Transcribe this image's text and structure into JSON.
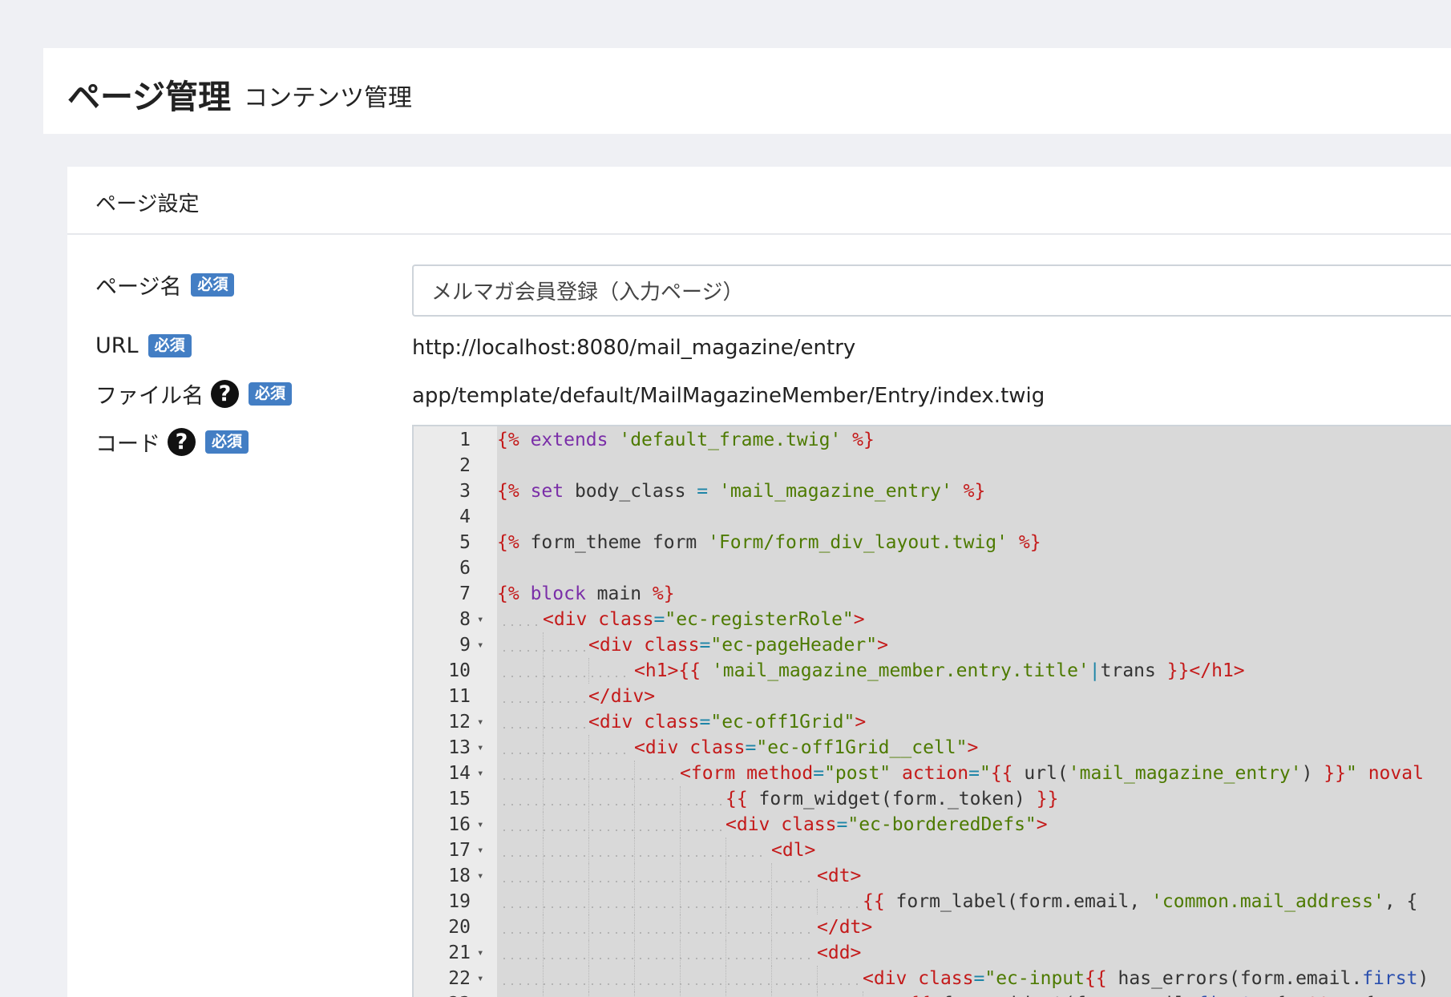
{
  "page_header": {
    "title": "ページ管理",
    "subtitle": "コンテンツ管理"
  },
  "card": {
    "title": "ページ設定"
  },
  "fields": {
    "page_name": {
      "label": "ページ名",
      "badge": "必須",
      "value": "メルマガ会員登録（入力ページ）"
    },
    "url": {
      "label": "URL",
      "badge": "必須",
      "value": "http://localhost:8080/mail_magazine/entry"
    },
    "file_name": {
      "label": "ファイル名",
      "badge": "必須",
      "help_icon": "question-circle-icon",
      "help_glyph": "?",
      "value": "app/template/default/MailMagazineMember/Entry/index.twig"
    },
    "code": {
      "label": "コード",
      "badge": "必須",
      "help_icon": "question-circle-icon",
      "help_glyph": "?"
    }
  },
  "colors": {
    "badge": "#437ec4",
    "page_bg": "#eff0f4",
    "editor_bg": "#d9d9d9",
    "gutter_bg": "#ebebeb",
    "twig_delim": "#c41a1a",
    "twig_keyword": "#7a2ea8",
    "string": "#4d7a00",
    "operator": "#1e85a7",
    "property": "#2a4fae"
  },
  "editor": {
    "fold_glyph": "▾",
    "lines": [
      {
        "n": "1",
        "fold": false,
        "indent": 0,
        "tokens": [
          [
            "delim",
            "{%"
          ],
          [
            "plain",
            " "
          ],
          [
            "kw",
            "extends"
          ],
          [
            "plain",
            " "
          ],
          [
            "str",
            "'default_frame.twig'"
          ],
          [
            "plain",
            " "
          ],
          [
            "delim",
            "%}"
          ]
        ]
      },
      {
        "n": "2",
        "fold": false,
        "indent": 0,
        "tokens": []
      },
      {
        "n": "3",
        "fold": false,
        "indent": 0,
        "tokens": [
          [
            "delim",
            "{%"
          ],
          [
            "plain",
            " "
          ],
          [
            "kw",
            "set"
          ],
          [
            "plain",
            " body_class "
          ],
          [
            "op",
            "="
          ],
          [
            "plain",
            " "
          ],
          [
            "str",
            "'mail_magazine_entry'"
          ],
          [
            "plain",
            " "
          ],
          [
            "delim",
            "%}"
          ]
        ]
      },
      {
        "n": "4",
        "fold": false,
        "indent": 0,
        "tokens": []
      },
      {
        "n": "5",
        "fold": false,
        "indent": 0,
        "tokens": [
          [
            "delim",
            "{%"
          ],
          [
            "plain",
            " form_theme form "
          ],
          [
            "str",
            "'Form/form_div_layout.twig'"
          ],
          [
            "plain",
            " "
          ],
          [
            "delim",
            "%}"
          ]
        ]
      },
      {
        "n": "6",
        "fold": false,
        "indent": 0,
        "tokens": []
      },
      {
        "n": "7",
        "fold": false,
        "indent": 0,
        "tokens": [
          [
            "delim",
            "{%"
          ],
          [
            "plain",
            " "
          ],
          [
            "kw",
            "block"
          ],
          [
            "plain",
            " main "
          ],
          [
            "delim",
            "%}"
          ]
        ]
      },
      {
        "n": "8",
        "fold": true,
        "indent": 1,
        "tokens": [
          [
            "tag",
            "<div"
          ],
          [
            "plain",
            " "
          ],
          [
            "attr",
            "class"
          ],
          [
            "op",
            "="
          ],
          [
            "attrval",
            "\"ec-registerRole\""
          ],
          [
            "tag",
            ">"
          ]
        ]
      },
      {
        "n": "9",
        "fold": true,
        "indent": 2,
        "tokens": [
          [
            "tag",
            "<div"
          ],
          [
            "plain",
            " "
          ],
          [
            "attr",
            "class"
          ],
          [
            "op",
            "="
          ],
          [
            "attrval",
            "\"ec-pageHeader\""
          ],
          [
            "tag",
            ">"
          ]
        ]
      },
      {
        "n": "10",
        "fold": false,
        "indent": 3,
        "tokens": [
          [
            "tag",
            "<h1>"
          ],
          [
            "delim",
            "{{"
          ],
          [
            "plain",
            " "
          ],
          [
            "str",
            "'mail_magazine_member.entry.title'"
          ],
          [
            "op",
            "|"
          ],
          [
            "plain",
            "trans "
          ],
          [
            "delim",
            "}}"
          ],
          [
            "tag",
            "</h1>"
          ]
        ]
      },
      {
        "n": "11",
        "fold": false,
        "indent": 2,
        "tokens": [
          [
            "tag",
            "</div>"
          ]
        ]
      },
      {
        "n": "12",
        "fold": true,
        "indent": 2,
        "tokens": [
          [
            "tag",
            "<div"
          ],
          [
            "plain",
            " "
          ],
          [
            "attr",
            "class"
          ],
          [
            "op",
            "="
          ],
          [
            "attrval",
            "\"ec-off1Grid\""
          ],
          [
            "tag",
            ">"
          ]
        ]
      },
      {
        "n": "13",
        "fold": true,
        "indent": 3,
        "tokens": [
          [
            "tag",
            "<div"
          ],
          [
            "plain",
            " "
          ],
          [
            "attr",
            "class"
          ],
          [
            "op",
            "="
          ],
          [
            "attrval",
            "\"ec-off1Grid__cell\""
          ],
          [
            "tag",
            ">"
          ]
        ]
      },
      {
        "n": "14",
        "fold": true,
        "indent": 4,
        "tokens": [
          [
            "tag",
            "<form"
          ],
          [
            "plain",
            " "
          ],
          [
            "attr",
            "method"
          ],
          [
            "op",
            "="
          ],
          [
            "attrval",
            "\"post\""
          ],
          [
            "plain",
            " "
          ],
          [
            "attr",
            "action"
          ],
          [
            "op",
            "="
          ],
          [
            "attrval",
            "\""
          ],
          [
            "delim",
            "{{"
          ],
          [
            "plain",
            " url("
          ],
          [
            "str",
            "'mail_magazine_entry'"
          ],
          [
            "plain",
            ") "
          ],
          [
            "delim",
            "}}"
          ],
          [
            "attrval",
            "\""
          ],
          [
            "plain",
            " "
          ],
          [
            "attr",
            "noval"
          ]
        ]
      },
      {
        "n": "15",
        "fold": false,
        "indent": 5,
        "tokens": [
          [
            "delim",
            "{{"
          ],
          [
            "plain",
            " form_widget(form._token) "
          ],
          [
            "delim",
            "}}"
          ]
        ]
      },
      {
        "n": "16",
        "fold": true,
        "indent": 5,
        "tokens": [
          [
            "tag",
            "<div"
          ],
          [
            "plain",
            " "
          ],
          [
            "attr",
            "class"
          ],
          [
            "op",
            "="
          ],
          [
            "attrval",
            "\"ec-borderedDefs\""
          ],
          [
            "tag",
            ">"
          ]
        ]
      },
      {
        "n": "17",
        "fold": true,
        "indent": 6,
        "tokens": [
          [
            "tag",
            "<dl>"
          ]
        ]
      },
      {
        "n": "18",
        "fold": true,
        "indent": 7,
        "tokens": [
          [
            "tag",
            "<dt>"
          ]
        ]
      },
      {
        "n": "19",
        "fold": false,
        "indent": 8,
        "tokens": [
          [
            "delim",
            "{{"
          ],
          [
            "plain",
            " form_label(form.email, "
          ],
          [
            "str",
            "'common.mail_address'"
          ],
          [
            "plain",
            ", {"
          ]
        ]
      },
      {
        "n": "20",
        "fold": false,
        "indent": 7,
        "tokens": [
          [
            "tag",
            "</dt>"
          ]
        ]
      },
      {
        "n": "21",
        "fold": true,
        "indent": 7,
        "tokens": [
          [
            "tag",
            "<dd>"
          ]
        ]
      },
      {
        "n": "22",
        "fold": true,
        "indent": 8,
        "tokens": [
          [
            "tag",
            "<div"
          ],
          [
            "plain",
            " "
          ],
          [
            "attr",
            "class"
          ],
          [
            "op",
            "="
          ],
          [
            "attrval",
            "\"ec-input"
          ],
          [
            "delim",
            "{{"
          ],
          [
            "plain",
            " has_errors(form.email."
          ],
          [
            "prop",
            "first"
          ],
          [
            "plain",
            ")"
          ]
        ]
      },
      {
        "n": "23",
        "fold": false,
        "indent": 9,
        "tokens": [
          [
            "delim",
            "{{"
          ],
          [
            "plain",
            " form_widget(form.email."
          ],
          [
            "prop",
            "first"
          ],
          [
            "plain",
            ", { "
          ],
          [
            "attr",
            "attr"
          ],
          [
            "plain",
            ": { "
          ],
          [
            "attr",
            "a"
          ]
        ]
      }
    ]
  }
}
